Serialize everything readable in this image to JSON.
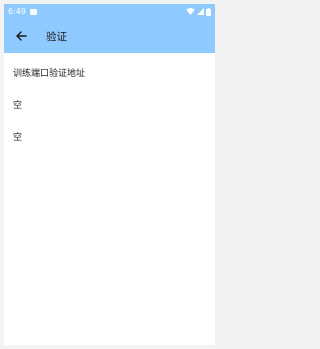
{
  "status_bar": {
    "time": "6:49",
    "icons": [
      "sd-card-icon",
      "wifi-icon",
      "signal-icon",
      "battery-icon"
    ]
  },
  "toolbar": {
    "back_icon": "arrow-left-icon",
    "title": "验证"
  },
  "content": {
    "items": [
      {
        "label": "训练端口验证地址"
      },
      {
        "label": "空"
      },
      {
        "label": "空"
      }
    ]
  },
  "colors": {
    "toolbar_bg": "#8ec9ff",
    "background": "#ffffff",
    "text": "#222222"
  }
}
